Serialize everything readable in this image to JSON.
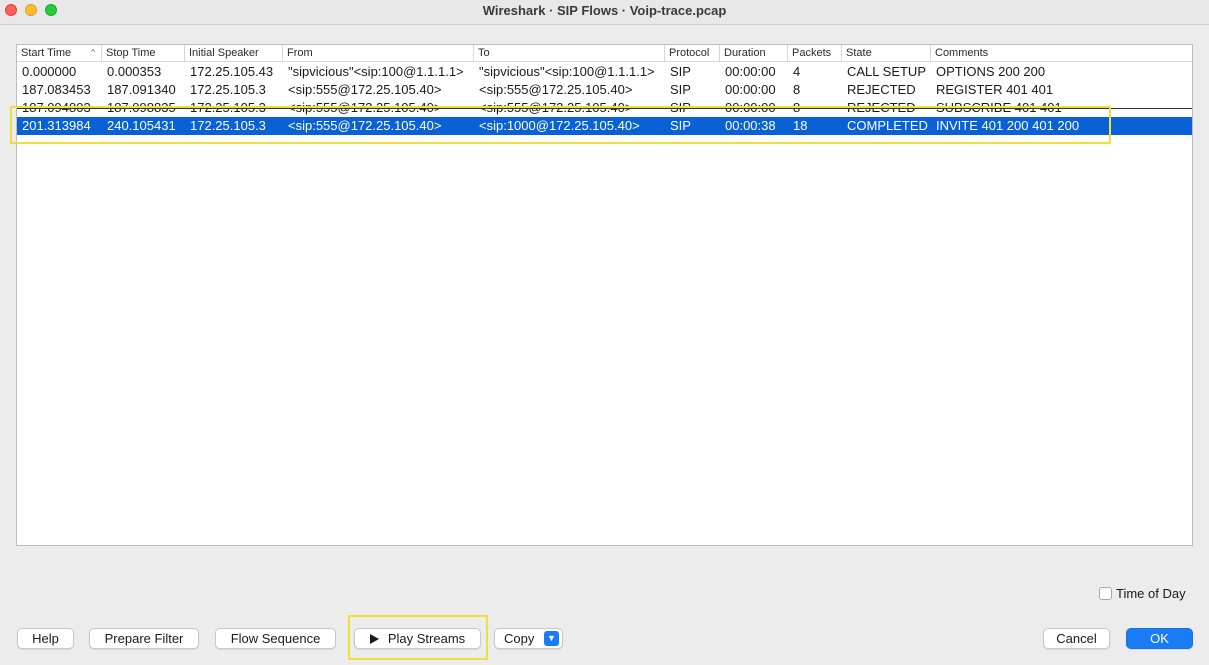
{
  "window": {
    "title": "Wireshark · SIP Flows · Voip-trace.pcap"
  },
  "table": {
    "columns": [
      "Start Time",
      "Stop Time",
      "Initial Speaker",
      "From",
      "To",
      "Protocol",
      "Duration",
      "Packets",
      "State",
      "Comments"
    ],
    "sort_indicator": "^",
    "rows": [
      [
        "0.000000",
        "0.000353",
        "172.25.105.43",
        "\"sipvicious\"<sip:100@1.1.1.1>",
        "\"sipvicious\"<sip:100@1.1.1.1>",
        "SIP",
        "00:00:00",
        "4",
        "CALL SETUP",
        "OPTIONS 200 200"
      ],
      [
        "187.083453",
        "187.091340",
        "172.25.105.3",
        "<sip:555@172.25.105.40>",
        "<sip:555@172.25.105.40>",
        "SIP",
        "00:00:00",
        "8",
        "REJECTED",
        "REGISTER 401 401"
      ],
      [
        "187.094803",
        "187.098835",
        "172.25.105.3",
        "<sip:555@172.25.105.40>",
        "<sip:555@172.25.105.40>",
        "SIP",
        "00:00:00",
        "8",
        "REJECTED",
        "SUBSCRIBE 401 401"
      ],
      [
        "201.313984",
        "240.105431",
        "172.25.105.3",
        "<sip:555@172.25.105.40>",
        "<sip:1000@172.25.105.40>",
        "SIP",
        "00:00:38",
        "18",
        "COMPLETED",
        "INVITE 401 200 401 200"
      ]
    ],
    "selected_row": 3
  },
  "options": {
    "time_of_day_label": "Time of Day",
    "time_of_day_checked": false
  },
  "buttons": {
    "help": "Help",
    "prepare_filter": "Prepare Filter",
    "flow_sequence": "Flow Sequence",
    "play_streams": "Play Streams",
    "copy": "Copy",
    "cancel": "Cancel",
    "ok": "OK"
  },
  "colors": {
    "selection": "#0a61d6",
    "accent": "#1a7cf5",
    "highlight_box": "#f0df3a"
  },
  "icons": {
    "play": "play-icon",
    "dropdown": "chevron-down-icon"
  }
}
